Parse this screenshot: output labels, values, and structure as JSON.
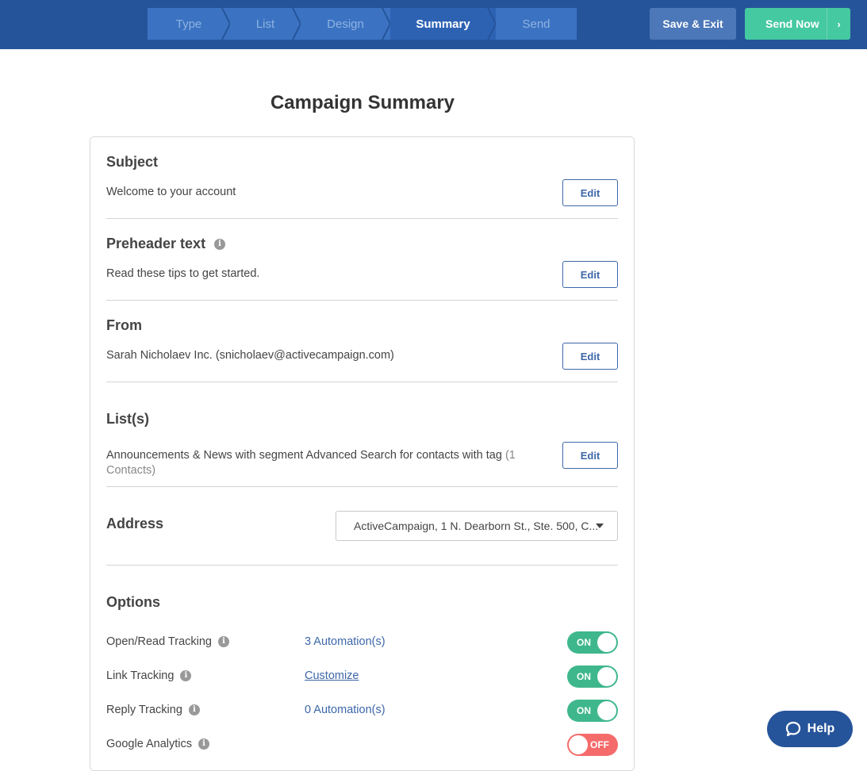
{
  "header": {
    "steps": [
      {
        "label": "Type"
      },
      {
        "label": "List"
      },
      {
        "label": "Design"
      },
      {
        "label": "Summary"
      },
      {
        "label": "Send"
      }
    ],
    "save_exit_label": "Save & Exit",
    "send_now_label": "Send Now",
    "send_now_chevron": "›"
  },
  "page_title": "Campaign Summary",
  "sections": {
    "subject": {
      "title": "Subject",
      "value": "Welcome to your account",
      "edit_label": "Edit"
    },
    "preheader": {
      "title": "Preheader text",
      "value": "Read these tips to get started.",
      "edit_label": "Edit"
    },
    "from": {
      "title": "From",
      "value": "Sarah Nicholaev Inc. (snicholaev@activecampaign.com)",
      "edit_label": "Edit"
    },
    "lists": {
      "title": "List(s)",
      "value": "Announcements & News with segment Advanced Search for contacts with tag",
      "count_line1": "(1",
      "count_line2": "Contacts)",
      "edit_label": "Edit"
    },
    "address": {
      "title": "Address",
      "selected": "ActiveCampaign, 1 N. Dearborn St., Ste. 500, C..."
    }
  },
  "options": {
    "title": "Options",
    "items": [
      {
        "label": "Open/Read Tracking",
        "link": "3 Automation(s)",
        "toggle": "ON"
      },
      {
        "label": "Link Tracking",
        "link": "Customize",
        "toggle": "ON"
      },
      {
        "label": "Reply Tracking",
        "link": "0 Automation(s)",
        "toggle": "ON"
      },
      {
        "label": "Google Analytics",
        "link": "",
        "toggle": "OFF"
      }
    ]
  },
  "info_glyph": "i",
  "help_label": "Help",
  "colors": {
    "header_bg": "#26549a",
    "step_active": "#2d62b3",
    "step_inactive": "#3b73c2",
    "send_green": "#45c9a0",
    "toggle_on": "#3fb78c",
    "toggle_off": "#f56b6b",
    "link_blue": "#3d67a8"
  }
}
